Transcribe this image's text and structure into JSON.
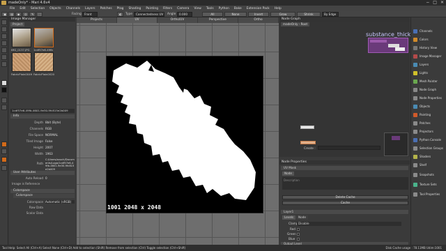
{
  "window": {
    "title": "madeOnly* - Mari 4.6v4",
    "controls": [
      "−",
      "□",
      "✕"
    ]
  },
  "menubar": [
    "File",
    "Edit",
    "Selection",
    "Objects",
    "Channels",
    "Layers",
    "Patches",
    "Ptag",
    "Shading",
    "Painting",
    "Filters",
    "Camera",
    "View",
    "Tools",
    "Python",
    "Bake",
    "Extension Pack",
    "Help"
  ],
  "toolbar": {
    "facing_label": "Facing",
    "facing_value": "Front",
    "type_label": "Type",
    "type_value": "Connectedness UV",
    "angle_label": "Angle",
    "angle_value": "0.000",
    "all_label": "All",
    "none_label": "None",
    "invert_label": "Invert",
    "grow_label": "Grow",
    "shrink_label": "Shrink",
    "by_edge_label": "By Edge"
  },
  "image_manager": {
    "title": "Image Manager",
    "tab": "Project",
    "thumbs": [
      {
        "label": "IMG_0137.JPG"
      },
      {
        "label": "1cdf57e6-49fb"
      },
      {
        "label": "FabricPlain0049"
      },
      {
        "label": "FabricPlain0020"
      }
    ],
    "image_id": "1cdf57e6-49fb-4601-9e30-9fc815e2b009",
    "info_header": "Info",
    "info": [
      {
        "key": "Depth",
        "value": "8bit (Byte)"
      },
      {
        "key": "Channels",
        "value": "RGB"
      },
      {
        "key": "File Space",
        "value": "NORMAL"
      },
      {
        "key": "Tiled Image",
        "value": "False"
      },
      {
        "key": "Height",
        "value": "2007"
      },
      {
        "key": "Width",
        "value": "1963"
      },
      {
        "key": "Path",
        "value": "C:/Users/sauch/Documents/Logo/1cdf57e6-49fb-4601-9e30-9fc815e2b009"
      }
    ],
    "user_attributes_header": "User Attributes",
    "auto_reload_label": "Auto Reload",
    "auto_reload_value": "0",
    "is_reference_label": "Image is Reference",
    "colorspace_header": "Colorspace",
    "colorspace_sub": "Colorspace",
    "cs_rows": [
      {
        "key": "Colorspace",
        "value": "Automatic (sRGB)"
      },
      {
        "key": "Raw Data",
        "value": ""
      },
      {
        "key": "Scalar Data",
        "value": ""
      }
    ]
  },
  "viewport": {
    "tabs": [
      "Projects",
      "UV",
      "Ortho/UV",
      "Perspective",
      "Ortho"
    ],
    "active_tab": "UV",
    "tile_label": "1001 2048 x 2048"
  },
  "node_graph": {
    "title": "Node Graph",
    "tab": "madeOnly - Root",
    "node_title": "substance_thickne",
    "create_label": "Create :"
  },
  "node_properties": {
    "title": "Node Properties",
    "uv_mask_header": "UV Mask",
    "node_tab": "Node",
    "description_label": "Description",
    "delete_cache": "Delete Cache",
    "cache": "Cache",
    "layer_header": "Layer1",
    "levels_tab": "Levels",
    "node_tab2": "Node",
    "clamp_label": "Clamp",
    "clamp_value": "Disable",
    "red_label": "Red",
    "green_label": "Green",
    "blue_label": "Blue",
    "output_level": "Output Level"
  },
  "sidebar": {
    "items": [
      {
        "label": "Channels",
        "color": "#4a6fb3"
      },
      {
        "label": "Colors",
        "color": "#d08a2a"
      },
      {
        "label": "History View",
        "color": "#777777"
      },
      {
        "label": "Image Manager",
        "color": "#b34a4a"
      },
      {
        "label": "Layers",
        "color": "#4a8bb3"
      },
      {
        "label": "Lights",
        "color": "#d0c02a"
      },
      {
        "label": "Mesh Painter",
        "color": "#6aa84f"
      },
      {
        "label": "Node Graph",
        "color": "#888888"
      },
      {
        "label": "Node Properties",
        "color": "#888888"
      },
      {
        "label": "Objects",
        "color": "#4a8bb3"
      },
      {
        "label": "Painting",
        "color": "#d05a2a"
      },
      {
        "label": "Patches",
        "color": "#8a8a8a"
      },
      {
        "label": "Projectors",
        "color": "#8a8a8a"
      },
      {
        "label": "Python Console",
        "color": "#4a6fb3"
      },
      {
        "label": "Selection Groups",
        "color": "#8a8a8a"
      },
      {
        "label": "Shaders",
        "color": "#b3b34a"
      },
      {
        "label": "Shelf",
        "color": "#8a8a8a"
      },
      {
        "label": "Snapshots",
        "color": "#8a8a8a"
      },
      {
        "label": "Texture Sets",
        "color": "#4ab38b"
      },
      {
        "label": "Tool Properties",
        "color": "#8a8a8a"
      }
    ]
  },
  "status": {
    "left": "Tool Help: Select All (Ctrl+A)    Select None (Ctrl+D)    Add to selection (Shift)    Remove from selection (Ctrl)    Toggle selection (Ctrl+Shift)",
    "right": "Disk Cache usage : 78.11MB  Udim:1001"
  }
}
